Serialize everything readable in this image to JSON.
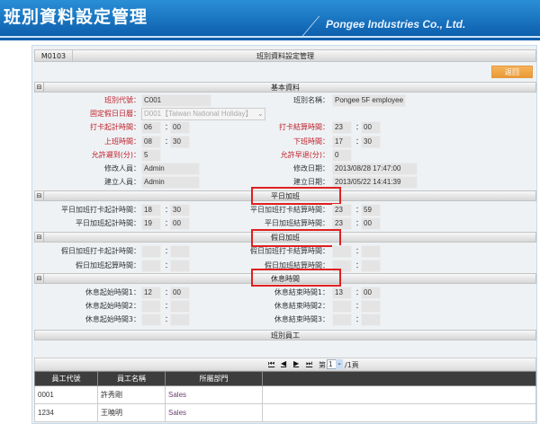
{
  "header": {
    "title": "班別資料設定管理",
    "company": "Pongee Industries Co., Ltd."
  },
  "panel": {
    "code": "M0103",
    "title": "班別資料設定管理",
    "return_label": "返回"
  },
  "sections": {
    "basic": "基本資料",
    "weekday_ot": "平日加班",
    "holiday_ot": "假日加班",
    "break": "休息時間",
    "employees": "班別員工"
  },
  "basic": {
    "shift_code_label": "班別代號：",
    "shift_code": "C001",
    "shift_name_label": "班別名稱：",
    "shift_name": "Pongee 5F employee",
    "holiday_cal_label": "固定假日日曆：",
    "holiday_cal": "D001【Taiwan National Holiday】",
    "clock_start_label": "打卡起計時間：",
    "clock_start_h": "06",
    "clock_start_m": "00",
    "clock_end_label": "打卡結算時間：",
    "clock_end_h": "23",
    "clock_end_m": "00",
    "work_start_label": "上班時間：",
    "work_start_h": "08",
    "work_start_m": "30",
    "work_end_label": "下班時間：",
    "work_end_h": "17",
    "work_end_m": "30",
    "late_label": "允許遲到(分)：",
    "late": "5",
    "early_label": "允許早退(分)：",
    "early": "0",
    "modifier_label": "修改人員：",
    "modifier": "Admin",
    "modified_label": "修改日期：",
    "modified": "2013/08/28 17:47:00",
    "creator_label": "建立人員：",
    "creator": "Admin",
    "created_label": "建立日期：",
    "created": "2013/05/22 14:41:39"
  },
  "weekday": {
    "clock_start_label": "平日加班打卡起計時間：",
    "clock_start_h": "18",
    "clock_start_m": "30",
    "clock_end_label": "平日加班打卡結算時間：",
    "clock_end_h": "23",
    "clock_end_m": "59",
    "start_label": "平日加班起計時間：",
    "start_h": "19",
    "start_m": "00",
    "end_label": "平日加班結算時間：",
    "end_h": "23",
    "end_m": "00"
  },
  "holiday": {
    "clock_start_label": "假日加班打卡起計時間：",
    "clock_end_label": "假日加班打卡結算時間：",
    "start_label": "假日加班起算時間：",
    "end_label": "假日加班結算時間："
  },
  "breaks": {
    "s1_label": "休息起始時間1：",
    "s1_h": "12",
    "s1_m": "00",
    "e1_label": "休息結束時間1：",
    "e1_h": "13",
    "e1_m": "00",
    "s2_label": "休息起始時間2：",
    "e2_label": "休息結束時間2：",
    "s3_label": "休息起始時間3：",
    "e3_label": "休息結束時間3："
  },
  "pager": {
    "prefix": "第",
    "page": "1",
    "suffix": "/1頁"
  },
  "table": {
    "headers": [
      "員工代號",
      "員工名稱",
      "所屬部門"
    ],
    "rows": [
      [
        "0001",
        "許秀剛",
        "Sales"
      ],
      [
        "1234",
        "王曉明",
        "Sales"
      ]
    ]
  },
  "colon": "："
}
